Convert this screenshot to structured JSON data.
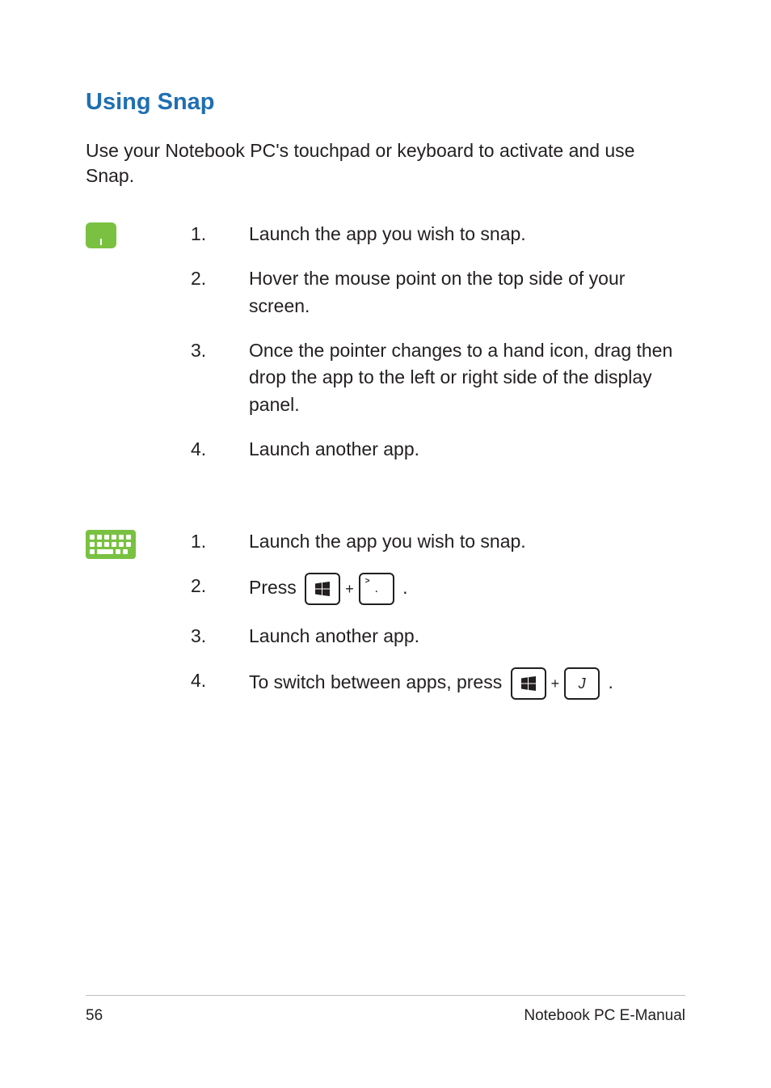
{
  "section_title": "Using Snap",
  "intro": "Use your Notebook PC's touchpad or keyboard to activate and use Snap.",
  "touchpad_steps": [
    "Launch the app you wish to snap.",
    "Hover the mouse point on the top side of your screen.",
    "Once the pointer changes to a hand icon, drag then drop the app to the left or right side of the display panel.",
    "Launch another app."
  ],
  "keyboard_steps": {
    "s1": "Launch the app you wish to snap.",
    "s2_prefix": "Press ",
    "s2_suffix": ".",
    "s3": "Launch another app.",
    "s4_prefix": "To switch between apps, press ",
    "s4_suffix": "."
  },
  "keys": {
    "plus": "+",
    "period_sup": ">",
    "period_center": ".",
    "j": "J"
  },
  "footer": {
    "page": "56",
    "title": "Notebook PC E-Manual"
  }
}
